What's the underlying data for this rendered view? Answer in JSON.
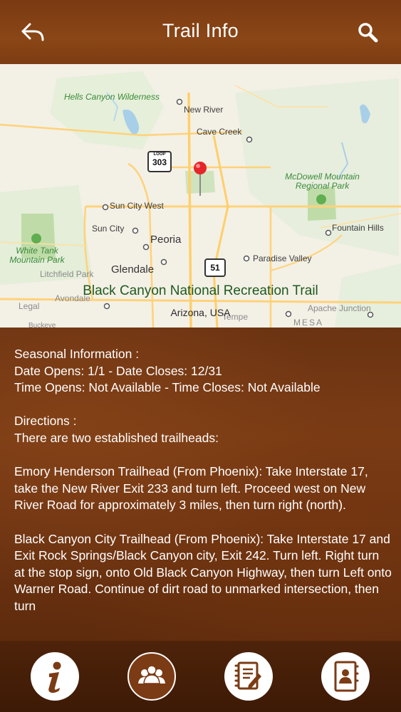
{
  "header": {
    "title": "Trail Info",
    "back_icon": "back-arrow-icon",
    "search_icon": "search-icon"
  },
  "map": {
    "places": {
      "hells_canyon": "Hells Canyon Wilderness",
      "new_river": "New River",
      "cave_creek": "Cave Creek",
      "mcdowell": "McDowell Mountain Regional Park",
      "sun_city_west": "Sun City West",
      "sun_city": "Sun City",
      "peoria": "Peoria",
      "fountain_hills": "Fountain Hills",
      "white_tank": "White Tank Mountain Park",
      "glendale": "Glendale",
      "paradise_valley": "Paradise Valley",
      "litchfield": "Litchfield Park",
      "avondale": "Avondale",
      "legal": "Legal",
      "apache_junction": "Apache Junction",
      "tempe": "Tempe",
      "mesa": "Mesa",
      "buckeye": "Buckeye"
    },
    "shield_loop": "LOOP",
    "shield_303": "303",
    "shield_51": "51",
    "trail_name": "Black Canyon National Recreation Trail",
    "location": "Arizona, USA"
  },
  "content": {
    "seasonal_heading": "Seasonal Information :",
    "dates": "Date Opens: 1/1 - Date Closes: 12/31",
    "times": "Time Opens: Not Available - Time Closes: Not Available",
    "directions_heading": "Directions :",
    "directions_intro": "There are two established trailheads:",
    "trailhead1": "Emory Henderson Trailhead (From Phoenix): Take Interstate 17, take the New River Exit 233 and turn left. Proceed west on New River Road for approximately 3 miles, then turn right (north).",
    "trailhead2": "Black Canyon City Trailhead (From Phoenix): Take Interstate 17 and Exit Rock Springs/Black Canyon city, Exit 242. Turn left. Right turn at the stop sign, onto Old Black Canyon Highway, then turn Left onto Warner Road. Continue of dirt road to unmarked intersection, then turn"
  },
  "tabbar": {
    "tabs": [
      {
        "icon": "info-icon",
        "active": false
      },
      {
        "icon": "people-icon",
        "active": true
      },
      {
        "icon": "notes-icon",
        "active": false
      },
      {
        "icon": "contacts-icon",
        "active": false
      }
    ]
  }
}
